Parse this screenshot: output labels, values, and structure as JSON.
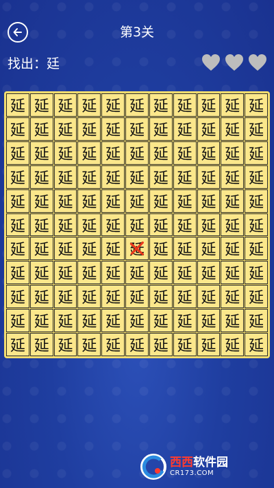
{
  "header": {
    "level_title": "第3关",
    "find_label": "找出：廷",
    "lives": 3
  },
  "board": {
    "rows": 11,
    "cols": 11,
    "common_char": "延",
    "marked_wrong": {
      "row": 6,
      "col": 5
    },
    "colors": {
      "board": "#f2dc6e",
      "cell": "#fbe78b",
      "mark": "#e8391c"
    }
  },
  "colors": {
    "background": "#1f3ea0",
    "heart": "#bdbdbd",
    "text": "#ffffff"
  },
  "icons": {
    "back": "arrow-left-circle-icon",
    "life": "heart-icon",
    "wrong": "x-mark-icon"
  },
  "watermark": {
    "title_part1": "西西",
    "title_part2": "软件园",
    "url": "CR173.COM"
  }
}
